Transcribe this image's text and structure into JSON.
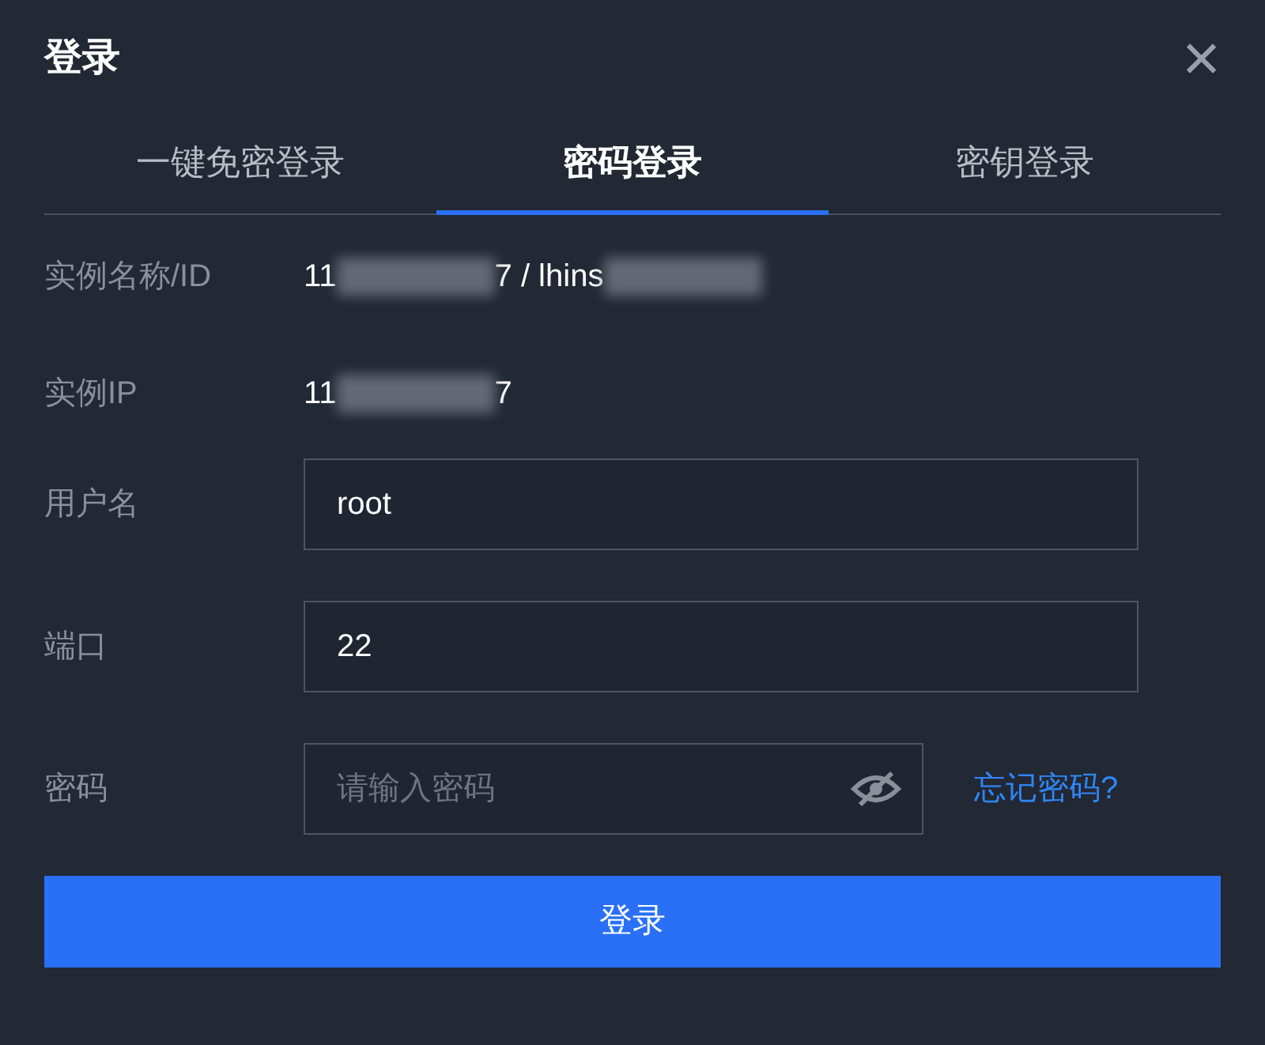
{
  "dialog": {
    "title": "登录",
    "close": "×"
  },
  "tabs": [
    {
      "label": "一键免密登录",
      "selected": false
    },
    {
      "label": "密码登录",
      "selected": true
    },
    {
      "label": "密钥登录",
      "selected": false
    }
  ],
  "info": [
    {
      "label": "实例名称/ID",
      "parts": [
        {
          "kind": "text",
          "text": "11"
        },
        {
          "kind": "redacted"
        },
        {
          "kind": "text",
          "text": "7 / lhins"
        },
        {
          "kind": "redacted"
        }
      ]
    },
    {
      "label": "实例IP",
      "parts": [
        {
          "kind": "text",
          "text": "11"
        },
        {
          "kind": "redacted"
        },
        {
          "kind": "text",
          "text": "7"
        }
      ]
    }
  ],
  "fields": [
    {
      "label": "用户名",
      "kind": "text",
      "value": "root"
    },
    {
      "label": "端口",
      "kind": "text",
      "value": "22"
    },
    {
      "label": "密码",
      "kind": "password",
      "placeholder": "请输入密码",
      "link": "忘记密码?"
    }
  ],
  "submit": "登录"
}
